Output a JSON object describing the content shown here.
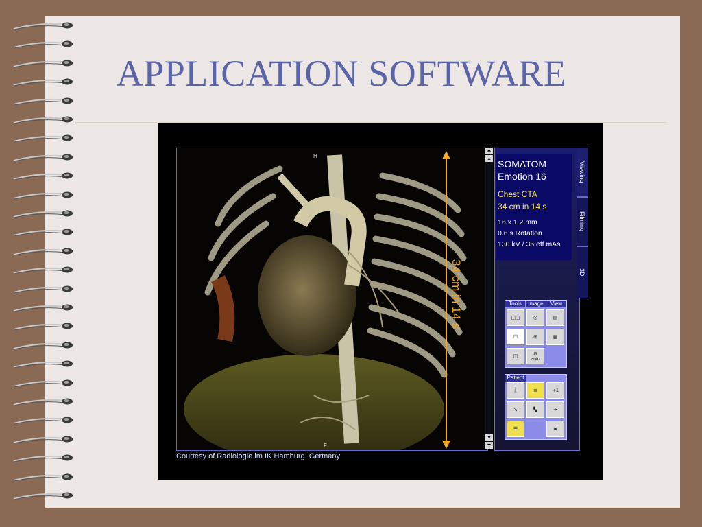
{
  "slide": {
    "title": "APPLICATION SOFTWARE"
  },
  "viewer": {
    "scanner_line1": "SOMATOM",
    "scanner_line2": "Emotion 16",
    "exam": "Chest CTA",
    "coverage": "34 cm in 14 s",
    "slices": "16 x 1.2 mm",
    "rotation": "0.6 s Rotation",
    "dose": "130 kV / 35 eff.mAs",
    "measure_label": "34 cm in 14 s",
    "orient_top": "H",
    "orient_bottom": "F",
    "tabs": [
      "Viewing",
      "Filming",
      "3D"
    ],
    "groups": {
      "tools": "Tools",
      "image": "Image",
      "view": "View",
      "patient": "Patient"
    },
    "auto_label": "auto",
    "patient_index": "1",
    "courtesy": "Courtesy of Radiologie im IK Hamburg, Germany"
  },
  "colors": {
    "title": "#5a64a8",
    "exam_text": "#ffe840",
    "measure": "#f5a623",
    "panel": "#0a0a66"
  }
}
